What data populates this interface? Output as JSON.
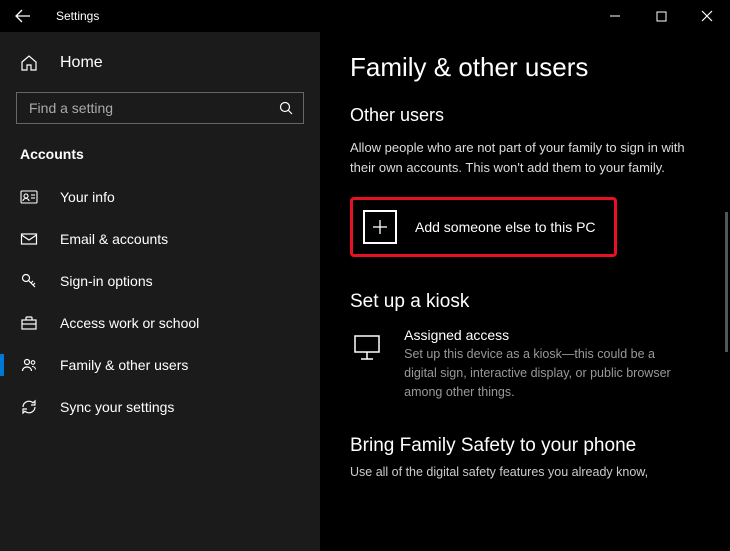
{
  "titlebar": {
    "title": "Settings"
  },
  "sidebar": {
    "home_label": "Home",
    "search_placeholder": "Find a setting",
    "category": "Accounts",
    "items": [
      {
        "label": "Your info"
      },
      {
        "label": "Email & accounts"
      },
      {
        "label": "Sign-in options"
      },
      {
        "label": "Access work or school"
      },
      {
        "label": "Family & other users"
      },
      {
        "label": "Sync your settings"
      }
    ]
  },
  "content": {
    "page_title": "Family & other users",
    "other_users": {
      "heading": "Other users",
      "description": "Allow people who are not part of your family to sign in with their own accounts. This won't add them to your family.",
      "add_label": "Add someone else to this PC"
    },
    "kiosk": {
      "heading": "Set up a kiosk",
      "item_title": "Assigned access",
      "item_desc": "Set up this device as a kiosk—this could be a digital sign, interactive display, or public browser among other things."
    },
    "family_safety": {
      "heading": "Bring Family Safety to your phone",
      "description": "Use all of the digital safety features you already know,"
    }
  }
}
